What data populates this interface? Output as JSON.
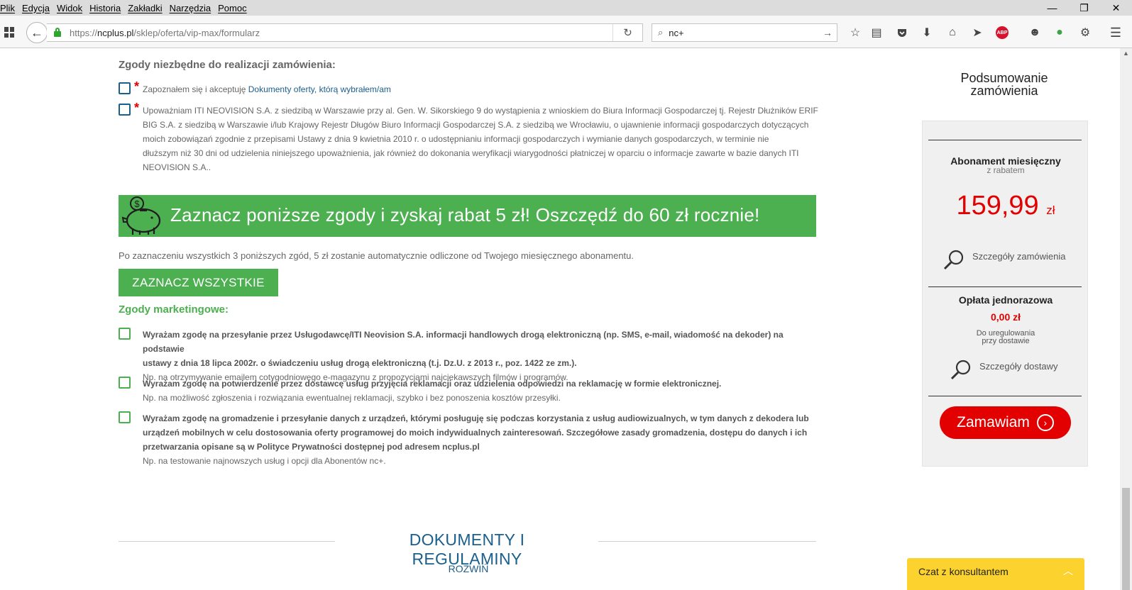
{
  "menu": {
    "items": [
      "Plik",
      "Edycja",
      "Widok",
      "Historia",
      "Zakładki",
      "Narzędzia",
      "Pomoc"
    ]
  },
  "window_controls": {
    "minimize": "—",
    "restore": "❐",
    "close": "✕"
  },
  "navbar": {
    "back_glyph": "←",
    "url_prefix": "https://",
    "url_host": "ncplus.pl",
    "url_path": "/sklep/oferta/vip-max/formularz",
    "reload_glyph": "↻",
    "search_value": "nc+",
    "search_glyph": "⌕",
    "search_go_glyph": "→",
    "icons": [
      "bookmark-star-icon",
      "reading-list-icon",
      "pocket-icon",
      "download-icon",
      "home-icon",
      "send-icon",
      "adblock-plus-icon",
      "emoji-icon",
      "green-extension-icon",
      "gear-extension-icon",
      "menu-icon"
    ],
    "abp_label": "ABP"
  },
  "required": {
    "heading": "Zgody niezbędne do realizacji zamówienia:",
    "consent1_text": "Zapoznałem się i akceptuję ",
    "consent1_link": "Dokumenty oferty, którą wybrałem/am",
    "consent2_lines": [
      "Upoważniam ITI NEOVISION S.A. z siedzibą w Warszawie przy al. Gen. W. Sikorskiego 9 do wystąpienia z wnioskiem do Biura Informacji Gospodarczej tj. Rejestr Dłużników ERIF",
      "BIG S.A. z siedzibą w Warszawie i/lub Krajowy Rejestr Długów Biuro Informacji Gospodarczej S.A. z siedzibą we Wrocławiu, o ujawnienie informacji gospodarczych dotyczących",
      "moich zobowiązań zgodnie z przepisami Ustawy z dnia 9 kwietnia 2010 r. o udostępnianiu informacji gospodarczych i wymianie danych gospodarczych, w terminie nie",
      "dłuższym niż 30 dni od udzielenia niniejszego upoważnienia, jak również do dokonania weryfikacji wiarygodności płatniczej w oparciu o informacje zawarte w bazie danych ITI",
      "NEOVISION S.A.."
    ],
    "star": "*"
  },
  "promo": {
    "text": "Zaznacz poniższe zgody i zyskaj rabat 5 zł! Oszczędź do 60 zł rocznie!",
    "coin_label": "$"
  },
  "auto_note": "Po zaznaczeniu wszystkich 3 poniższych zgód, 5 zł zostanie automatycznie odliczone od Twojego miesięcznego abonamentu.",
  "select_all_button": "ZAZNACZ WSZYSTKIE",
  "marketing": {
    "heading": "Zgody marketingowe:",
    "consent1_lines": [
      "Wyrażam zgodę na przesyłanie przez Usługodawcę/ITI Neovision S.A. informacji handlowych drogą elektroniczną (np. SMS, e-mail, wiadomość na dekoder) na podstawie",
      "ustawy z dnia 18 lipca 2002r. o świadczeniu usług drogą elektroniczną (t.j. Dz.U. z 2013 r., poz. 1422 ze zm.)."
    ],
    "consent1_example": "Np. na otrzymywanie emailem cotygodniowego e-magazynu z propozycjami najciekawszych filmów i programów.",
    "consent2_lines": [
      "Wyrażam zgodę na potwierdzenie przez dostawcę usług przyjęcia reklamacji oraz udzielenia odpowiedzi na reklamację w formie elektronicznej."
    ],
    "consent2_example": "Np. na możliwość zgłoszenia i rozwiązania ewentualnej reklamacji, szybko i bez ponoszenia kosztów przesyłki.",
    "consent3_lines": [
      "Wyrażam zgodę na gromadzenie i przesyłanie danych z urządzeń, którymi posługuję się podczas korzystania z usług audiowizualnych, w tym danych z dekodera lub",
      "urządzeń mobilnych w celu dostosowania oferty programowej do moich indywidualnych zainteresowań. Szczegółowe zasady gromadzenia, dostępu do danych i ich",
      "przetwarzania opisane są w Polityce Prywatności dostępnej pod adresem ncplus.pl"
    ],
    "consent3_example": "Np. na testowanie najnowszych usług i opcji dla Abonentów nc+."
  },
  "documents": {
    "title": "DOKUMENTY I REGULAMINY",
    "expand": "ROZWIŃ"
  },
  "summary": {
    "title_line1": "Podsumowanie",
    "title_line2": "zamówienia",
    "monthly_label": "Abonament miesięczny",
    "monthly_sub": "z rabatem",
    "monthly_price": "159,99",
    "currency": "zł",
    "order_details": "Szczegóły zamówienia",
    "onetime_label": "Opłata jednorazowa",
    "onetime_price": "0,00 zł",
    "pay_note_line1": "Do uregulowania",
    "pay_note_line2": "przy dostawie",
    "delivery_details": "Szczegóły dostawy",
    "order_button": "Zamawiam",
    "order_arrow": "›",
    "accent_color": "#e30000"
  },
  "chat": {
    "label": "Czat z konsultantem",
    "toggle": "︿"
  },
  "colors": {
    "green": "#4caf50",
    "blue": "#1b5f8c",
    "red": "#e30000",
    "chat_yellow": "#fcd22e"
  }
}
